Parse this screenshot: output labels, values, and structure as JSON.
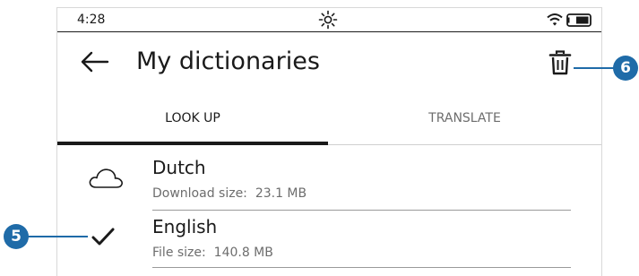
{
  "status": {
    "time": "4:28",
    "sun_icon": "brightness-icon",
    "wifi_icon": "wifi-icon",
    "battery_icon": "battery-icon"
  },
  "header": {
    "back_icon": "back-arrow-icon",
    "title": "My dictionaries",
    "delete_icon": "trash-icon"
  },
  "tabs": [
    {
      "label": "LOOK UP",
      "selected": true
    },
    {
      "label": "TRANSLATE",
      "selected": false
    }
  ],
  "dictionaries": [
    {
      "name": "Dutch",
      "meta_label": "Download size:",
      "meta_value": "23.1 MB",
      "status_icon": "cloud-icon"
    },
    {
      "name": "English",
      "meta_label": "File size:",
      "meta_value": "140.8 MB",
      "status_icon": "checkmark-icon"
    }
  ],
  "callouts": [
    {
      "number": "5",
      "target": "English checkmark"
    },
    {
      "number": "6",
      "target": "delete button"
    }
  ],
  "colors": {
    "callout": "#1f6ba8",
    "text": "#1a1a1a",
    "secondary_text": "#6d6d6d"
  }
}
